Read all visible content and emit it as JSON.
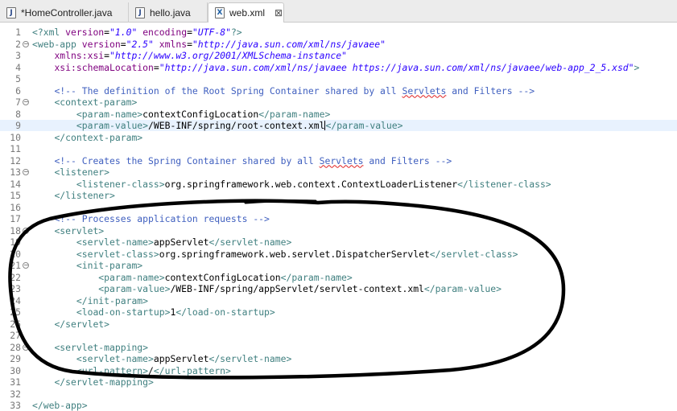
{
  "tabs": [
    {
      "label": "*HomeController.java",
      "icon": "java-file-icon",
      "glyph": "J"
    },
    {
      "label": "hello.java",
      "icon": "java-file-icon",
      "glyph": "J"
    },
    {
      "label": "web.xml",
      "icon": "xml-file-icon",
      "glyph": "X",
      "active": true
    }
  ],
  "close_glyph": "⊠",
  "lines": [
    {
      "n": "1",
      "seg": [
        [
          "tag",
          "<?xml "
        ],
        [
          "attr",
          "version"
        ],
        [
          "txt",
          "="
        ],
        [
          "val",
          "\"1.0\""
        ],
        [
          "txt",
          " "
        ],
        [
          "attr",
          "encoding"
        ],
        [
          "txt",
          "="
        ],
        [
          "val",
          "\"UTF-8\""
        ],
        [
          "tag",
          "?>"
        ]
      ]
    },
    {
      "n": "2",
      "fold": true,
      "seg": [
        [
          "tag",
          "<web-app "
        ],
        [
          "attr",
          "version"
        ],
        [
          "txt",
          "="
        ],
        [
          "val",
          "\"2.5\""
        ],
        [
          "txt",
          " "
        ],
        [
          "attr",
          "xmlns"
        ],
        [
          "txt",
          "="
        ],
        [
          "val",
          "\"http://java.sun.com/xml/ns/javaee\""
        ]
      ]
    },
    {
      "n": "3",
      "seg": [
        [
          "txt",
          "    "
        ],
        [
          "attr",
          "xmlns:xsi"
        ],
        [
          "txt",
          "="
        ],
        [
          "val",
          "\"http://www.w3.org/2001/XMLSchema-instance\""
        ]
      ]
    },
    {
      "n": "4",
      "seg": [
        [
          "txt",
          "    "
        ],
        [
          "attr",
          "xsi:schemaLocation"
        ],
        [
          "txt",
          "="
        ],
        [
          "val",
          "\"http://java.sun.com/xml/ns/javaee https://java.sun.com/xml/ns/javaee/web-app_2_5.xsd\""
        ],
        [
          "tag",
          ">"
        ]
      ]
    },
    {
      "n": "5",
      "seg": []
    },
    {
      "n": "6",
      "seg": [
        [
          "txt",
          "    "
        ],
        [
          "cmt",
          "<!-- The definition of the Root Spring Container shared by all "
        ],
        [
          "cmtsq",
          "Servlets"
        ],
        [
          "cmt",
          " and Filters -->"
        ]
      ]
    },
    {
      "n": "7",
      "fold": true,
      "seg": [
        [
          "txt",
          "    "
        ],
        [
          "tag",
          "<context-param>"
        ]
      ]
    },
    {
      "n": "8",
      "seg": [
        [
          "txt",
          "        "
        ],
        [
          "tag",
          "<param-name>"
        ],
        [
          "txt",
          "contextConfigLocation"
        ],
        [
          "tag",
          "</param-name>"
        ]
      ]
    },
    {
      "n": "9",
      "cur": true,
      "seg": [
        [
          "txt",
          "        "
        ],
        [
          "tag",
          "<param-value>"
        ],
        [
          "txt",
          "/WEB-INF/spring/root-context.xml"
        ],
        [
          "caret",
          ""
        ],
        [
          "tag",
          "</param-value>"
        ]
      ]
    },
    {
      "n": "10",
      "seg": [
        [
          "txt",
          "    "
        ],
        [
          "tag",
          "</context-param>"
        ]
      ]
    },
    {
      "n": "11",
      "seg": []
    },
    {
      "n": "12",
      "seg": [
        [
          "txt",
          "    "
        ],
        [
          "cmt",
          "<!-- Creates the Spring Container shared by all "
        ],
        [
          "cmtsq",
          "Servlets"
        ],
        [
          "cmt",
          " and Filters -->"
        ]
      ]
    },
    {
      "n": "13",
      "fold": true,
      "seg": [
        [
          "txt",
          "    "
        ],
        [
          "tag",
          "<listener>"
        ]
      ]
    },
    {
      "n": "14",
      "seg": [
        [
          "txt",
          "        "
        ],
        [
          "tag",
          "<listener-class>"
        ],
        [
          "txt",
          "org.springframework.web.context.ContextLoaderListener"
        ],
        [
          "tag",
          "</listener-class>"
        ]
      ]
    },
    {
      "n": "15",
      "seg": [
        [
          "txt",
          "    "
        ],
        [
          "tag",
          "</listener>"
        ]
      ]
    },
    {
      "n": "16",
      "seg": []
    },
    {
      "n": "17",
      "seg": [
        [
          "txt",
          "    "
        ],
        [
          "cmt",
          "<!-- Processes application requests -->"
        ]
      ]
    },
    {
      "n": "18",
      "fold": true,
      "seg": [
        [
          "txt",
          "    "
        ],
        [
          "tag",
          "<servlet>"
        ]
      ]
    },
    {
      "n": "19",
      "seg": [
        [
          "txt",
          "        "
        ],
        [
          "tag",
          "<servlet-name>"
        ],
        [
          "txt",
          "appServlet"
        ],
        [
          "tag",
          "</servlet-name>"
        ]
      ]
    },
    {
      "n": "20",
      "seg": [
        [
          "txt",
          "        "
        ],
        [
          "tag",
          "<servlet-class>"
        ],
        [
          "txt",
          "org.springframework.web.servlet.DispatcherServlet"
        ],
        [
          "tag",
          "</servlet-class>"
        ]
      ]
    },
    {
      "n": "21",
      "fold": true,
      "seg": [
        [
          "txt",
          "        "
        ],
        [
          "tag",
          "<init-param>"
        ]
      ]
    },
    {
      "n": "22",
      "seg": [
        [
          "txt",
          "            "
        ],
        [
          "tag",
          "<param-name>"
        ],
        [
          "txt",
          "contextConfigLocation"
        ],
        [
          "tag",
          "</param-name>"
        ]
      ]
    },
    {
      "n": "23",
      "seg": [
        [
          "txt",
          "            "
        ],
        [
          "tag",
          "<param-value>"
        ],
        [
          "txt",
          "/WEB-INF/spring/appServlet/servlet-context.xml"
        ],
        [
          "tag",
          "</param-value>"
        ]
      ]
    },
    {
      "n": "24",
      "seg": [
        [
          "txt",
          "        "
        ],
        [
          "tag",
          "</init-param>"
        ]
      ]
    },
    {
      "n": "25",
      "seg": [
        [
          "txt",
          "        "
        ],
        [
          "tag",
          "<load-on-startup>"
        ],
        [
          "txt",
          "1"
        ],
        [
          "tag",
          "</load-on-startup>"
        ]
      ]
    },
    {
      "n": "26",
      "seg": [
        [
          "txt",
          "    "
        ],
        [
          "tag",
          "</servlet>"
        ]
      ]
    },
    {
      "n": "27",
      "seg": []
    },
    {
      "n": "28",
      "fold": true,
      "seg": [
        [
          "txt",
          "    "
        ],
        [
          "tag",
          "<servlet-mapping>"
        ]
      ]
    },
    {
      "n": "29",
      "seg": [
        [
          "txt",
          "        "
        ],
        [
          "tag",
          "<servlet-name>"
        ],
        [
          "txt",
          "appServlet"
        ],
        [
          "tag",
          "</servlet-name>"
        ]
      ]
    },
    {
      "n": "30",
      "seg": [
        [
          "txt",
          "        "
        ],
        [
          "tag",
          "<url-pattern>"
        ],
        [
          "txt",
          "/"
        ],
        [
          "tag",
          "</url-pattern>"
        ]
      ]
    },
    {
      "n": "31",
      "seg": [
        [
          "txt",
          "    "
        ],
        [
          "tag",
          "</servlet-mapping>"
        ]
      ]
    },
    {
      "n": "32",
      "seg": []
    },
    {
      "n": "33",
      "seg": [
        [
          "tag",
          "</web-app>"
        ]
      ]
    }
  ],
  "colors": {
    "tag": "#3f7f7f",
    "attribute": "#7f007f",
    "value": "#2a00ff",
    "comment": "#3f5fbf",
    "current_line": "#e8f2fe",
    "annotation_ink": "#000000"
  }
}
